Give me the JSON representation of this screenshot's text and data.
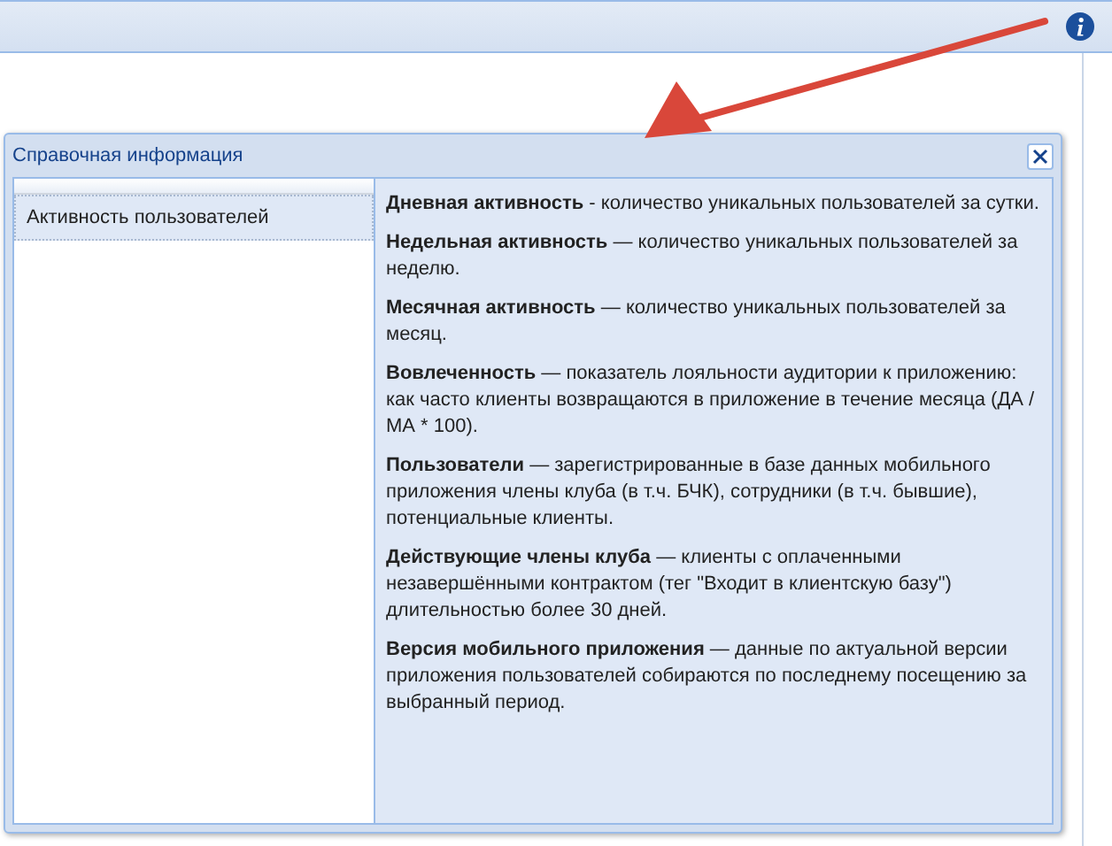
{
  "dialog": {
    "title": "Справочная информация",
    "list": [
      {
        "label": "Активность пользователей",
        "selected": true
      }
    ],
    "paragraphs": [
      "**Дневная активность** - количество уникальных пользователей за сутки.",
      "**Недельная активность** — количество уникальных пользователей за неделю.",
      "**Месячная активность** — количество уникальных пользователей за месяц.",
      "**Вовлеченность** — показатель лояльности аудитории к приложению: как часто клиенты возвращаются в приложение в течение месяца (ДА / МА * 100).",
      "**Пользователи** — зарегистрированные в базе данных мобильного приложения члены клуба (в т.ч. БЧК), сотрудники (в т.ч. бывшие), потенциальные клиенты.",
      "**Действующие члены клуба** — клиенты с оплаченными незавершёнными контрактом (тег \"Входит в клиентскую базу\") длительностью более 30 дней.",
      "**Версия мобильного приложения** — данные по актуальной версии приложения пользователей собираются по последнему посещению за выбранный период."
    ]
  }
}
